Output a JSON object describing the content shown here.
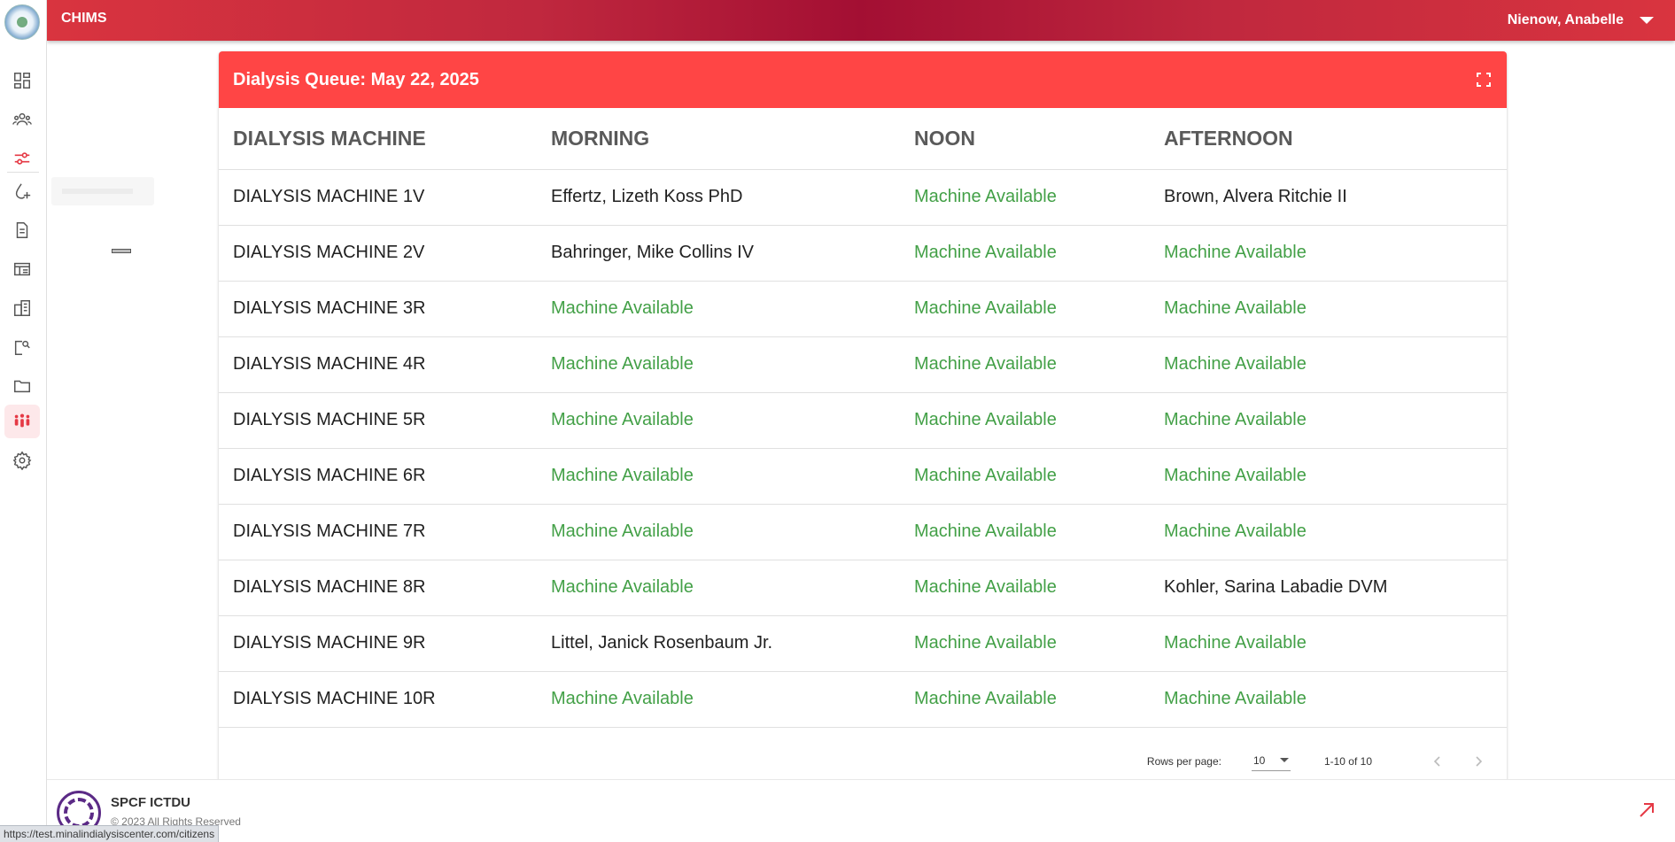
{
  "app": {
    "brand": "CHIMS",
    "user": "Nienow, Anabelle"
  },
  "sidebar": {
    "items": [
      {
        "icon": "dashboard-icon"
      },
      {
        "icon": "people-icon"
      },
      {
        "icon": "sliders-icon"
      },
      {
        "icon": "water-drop-add-icon"
      },
      {
        "icon": "document-icon"
      },
      {
        "icon": "table-icon"
      },
      {
        "icon": "building-icon"
      },
      {
        "icon": "document-search-icon"
      },
      {
        "icon": "folder-icon"
      },
      {
        "icon": "group-icon",
        "active": true
      },
      {
        "icon": "gear-icon"
      }
    ]
  },
  "queue": {
    "title": "Dialysis Queue: May 22, 2025",
    "columns": [
      "DIALYSIS MACHINE",
      "MORNING",
      "NOON",
      "AFTERNOON"
    ],
    "rows": [
      [
        "DIALYSIS MACHINE 1V",
        "Effertz, Lizeth Koss PhD",
        "Machine Available",
        "Brown, Alvera Ritchie II"
      ],
      [
        "DIALYSIS MACHINE 2V",
        "Bahringer, Mike Collins IV",
        "Machine Available",
        "Machine Available"
      ],
      [
        "DIALYSIS MACHINE 3R",
        "Machine Available",
        "Machine Available",
        "Machine Available"
      ],
      [
        "DIALYSIS MACHINE 4R",
        "Machine Available",
        "Machine Available",
        "Machine Available"
      ],
      [
        "DIALYSIS MACHINE 5R",
        "Machine Available",
        "Machine Available",
        "Machine Available"
      ],
      [
        "DIALYSIS MACHINE 6R",
        "Machine Available",
        "Machine Available",
        "Machine Available"
      ],
      [
        "DIALYSIS MACHINE 7R",
        "Machine Available",
        "Machine Available",
        "Machine Available"
      ],
      [
        "DIALYSIS MACHINE 8R",
        "Machine Available",
        "Machine Available",
        "Kohler, Sarina Labadie DVM"
      ],
      [
        "DIALYSIS MACHINE 9R",
        "Littel, Janick Rosenbaum Jr.",
        "Machine Available",
        "Machine Available"
      ],
      [
        "DIALYSIS MACHINE 10R",
        "Machine Available",
        "Machine Available",
        "Machine Available"
      ]
    ],
    "available_text": "Machine Available",
    "available_color": "#43a047",
    "header_color": "#ff4545"
  },
  "pagination": {
    "rows_label": "Rows per page:",
    "rows_value": "10",
    "range": "1-10 of 10"
  },
  "footer": {
    "org": "SPCF ICTDU",
    "copyright": "© 2023 All Rights Reserved"
  },
  "status_url": "https://test.minalindialysiscenter.com/citizens"
}
